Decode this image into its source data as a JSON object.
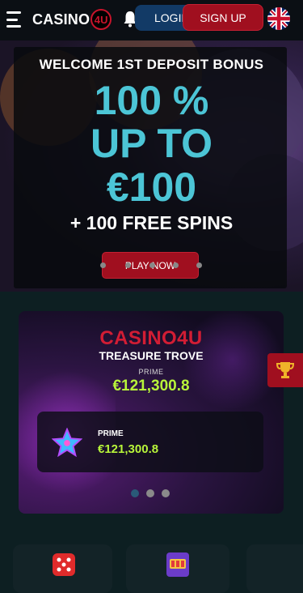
{
  "header": {
    "logo_text_main": "CASINO",
    "logo_badge": "4U",
    "login_label": "LOGIN",
    "signup_label": "SIGN UP",
    "language": "EN"
  },
  "hero": {
    "title": "WELCOME 1ST DEPOSIT BONUS",
    "line1": "100 %",
    "line2": "UP TO",
    "line3": "€100",
    "subtitle": "+ 100 FREE SPINS",
    "cta_label": "PLAY NOW",
    "slide_count": 5
  },
  "jackpot": {
    "brand": "CASINO4U",
    "name": "TREASURE TROVE",
    "tier": "PRIME",
    "amount": "€121,300.8",
    "inner_tier": "PRIME",
    "inner_amount": "€121,300.8",
    "slide_count": 3,
    "active_slide": 1
  },
  "colors": {
    "brand_red": "#a00f1f",
    "login_blue": "#123a66",
    "hero_cyan": "#4cc5d6",
    "jackpot_green": "#b8f53a"
  },
  "icons": [
    "menu-icon",
    "bell-icon",
    "uk-flag-icon",
    "star-icon",
    "trophy-icon",
    "dice-icon",
    "slot-machine-icon"
  ]
}
